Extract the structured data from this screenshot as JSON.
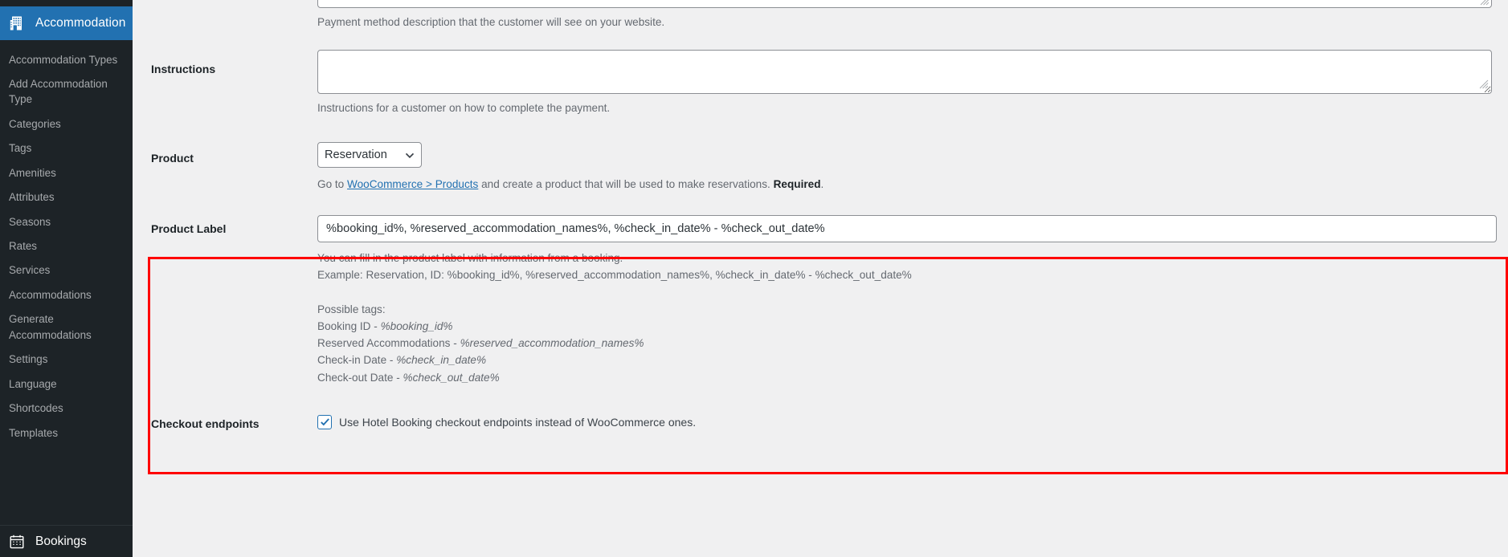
{
  "sidebar": {
    "active_menu": {
      "label": "Accommodation",
      "icon": "building-icon"
    },
    "items": [
      {
        "label": "Accommodation Types"
      },
      {
        "label": "Add Accommodation Type"
      },
      {
        "label": "Categories"
      },
      {
        "label": "Tags"
      },
      {
        "label": "Amenities"
      },
      {
        "label": "Attributes"
      },
      {
        "label": "Seasons"
      },
      {
        "label": "Rates"
      },
      {
        "label": "Services"
      },
      {
        "label": "Accommodations"
      },
      {
        "label": "Generate Accommodations"
      },
      {
        "label": "Settings"
      },
      {
        "label": "Language"
      },
      {
        "label": "Shortcodes"
      },
      {
        "label": "Templates"
      }
    ],
    "footer_menu": {
      "label": "Bookings",
      "icon": "calendar-icon"
    },
    "colors": {
      "background": "#1d2327",
      "active": "#2271b1",
      "text": "#a7aaad"
    }
  },
  "settings": {
    "description_field": {
      "value": "",
      "help": "Payment method description that the customer will see on your website."
    },
    "instructions": {
      "label": "Instructions",
      "value": "",
      "help": "Instructions for a customer on how to complete the payment."
    },
    "product": {
      "label": "Product",
      "selected": "Reservation",
      "options": [
        "Reservation"
      ],
      "help_prefix": "Go to ",
      "help_link": "WooCommerce > Products",
      "help_middle": " and create a product that will be used to make reservations. ",
      "help_required": "Required",
      "help_suffix": "."
    },
    "product_label": {
      "label": "Product Label",
      "value": "%booking_id%, %reserved_accommodation_names%, %check_in_date% - %check_out_date%",
      "help_line_1": "You can fill in the product label with information from a booking.",
      "help_line_2": "Example: Reservation, ID: %booking_id%, %reserved_accommodation_names%, %check_in_date% - %check_out_date%",
      "tags_heading": "Possible tags:",
      "tags": [
        {
          "name": "Booking ID - ",
          "tag": "%booking_id%"
        },
        {
          "name": "Reserved Accommodations - ",
          "tag": "%reserved_accommodation_names%"
        },
        {
          "name": "Check-in Date - ",
          "tag": "%check_in_date%"
        },
        {
          "name": "Check-out Date - ",
          "tag": "%check_out_date%"
        }
      ],
      "highlight_color": "#ff0000"
    },
    "checkout_endpoints": {
      "label": "Checkout endpoints",
      "checkbox_label": "Use Hotel Booking checkout endpoints instead of WooCommerce ones.",
      "checked": true
    }
  }
}
